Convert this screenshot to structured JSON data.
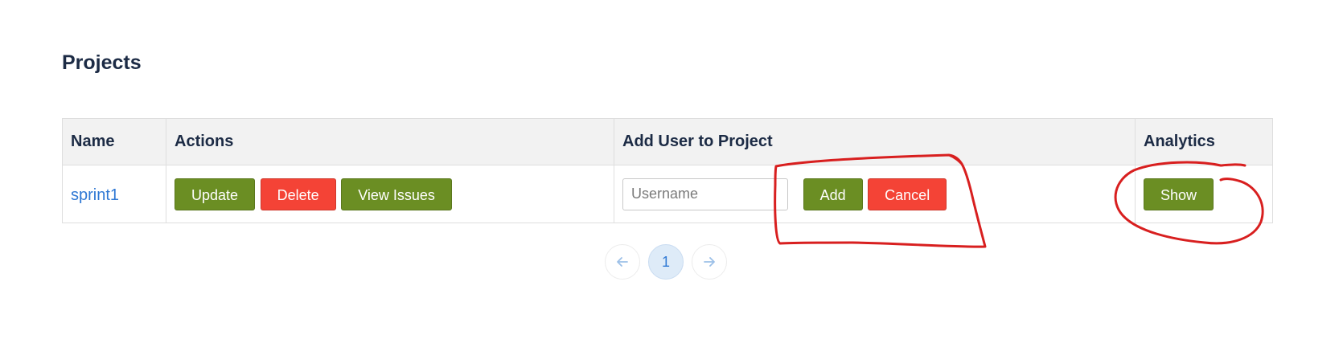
{
  "page": {
    "title": "Projects"
  },
  "table": {
    "headers": [
      "Name",
      "Actions",
      "Add User to Project",
      "Analytics"
    ],
    "rows": [
      {
        "name": "sprint1",
        "actions": {
          "update": "Update",
          "delete": "Delete",
          "view_issues": "View Issues"
        },
        "add_user": {
          "placeholder": "Username",
          "value": "",
          "add": "Add",
          "cancel": "Cancel"
        },
        "analytics": {
          "show": "Show"
        }
      }
    ]
  },
  "pagination": {
    "current_page": "1",
    "prev_icon": "arrow-left-icon",
    "next_icon": "arrow-right-icon"
  },
  "colors": {
    "primary_green": "#6b8e23",
    "danger_red": "#f44336",
    "link_blue": "#2f78d4",
    "annotation_red": "#d81f1f"
  }
}
